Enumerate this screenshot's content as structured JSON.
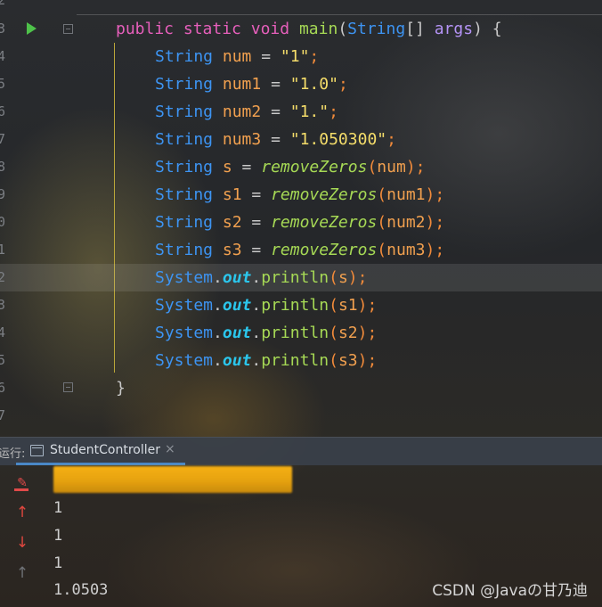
{
  "editor": {
    "line_numbers": [
      "2",
      "3",
      "4",
      "5",
      "6",
      "7",
      "8",
      "9",
      "0",
      "1",
      "2",
      "3",
      "4",
      "5",
      "6",
      "7"
    ],
    "code": {
      "main_sig": {
        "public": "public",
        "static": "static",
        "void": "void",
        "main": "main",
        "paren_open": "(",
        "string_type": "String",
        "brackets": "[] ",
        "args": "args",
        "close": ") {"
      },
      "decl_type": "String",
      "assign": " = ",
      "semi": ";",
      "lit_num": "\"1\"",
      "lit_num1": "\"1.0\"",
      "lit_num2": "\"1.\"",
      "lit_num3": "\"1.050300\"",
      "var_num": "num",
      "var_num1": "num1",
      "var_num2": "num2",
      "var_num3": "num3",
      "var_s": "s",
      "var_s1": "s1",
      "var_s2": "s2",
      "var_s3": "s3",
      "fn_remove": "removeZeros",
      "system": "System",
      "dot": ".",
      "out": "out",
      "println": "println",
      "lp": "(",
      "rp": ")",
      "brace_close": "}"
    }
  },
  "run_panel": {
    "prefix": "运行:",
    "tab_label": "StudentController",
    "tab_close": "×",
    "output_lines": [
      "1",
      "1",
      "1",
      "1.0503"
    ]
  },
  "watermark": "CSDN @Javaの甘乃迪",
  "colors": {
    "keyword": "#e65fbb",
    "type": "#3d94f2",
    "variable": "#f1a04f",
    "string": "#f5dd6a",
    "method": "#a6d955",
    "static_field": "#2bc6ec",
    "param": "#b493f5",
    "indent_guide": "#bba73a",
    "tab_underline": "#4a88c7"
  },
  "icons": {
    "gutter_run": "run-triangle-icon",
    "fold": "fold-marker-icon",
    "tab": "console-icon",
    "clear": "clear-all-icon",
    "up": "up-arrow-icon",
    "down": "down-arrow-icon"
  }
}
